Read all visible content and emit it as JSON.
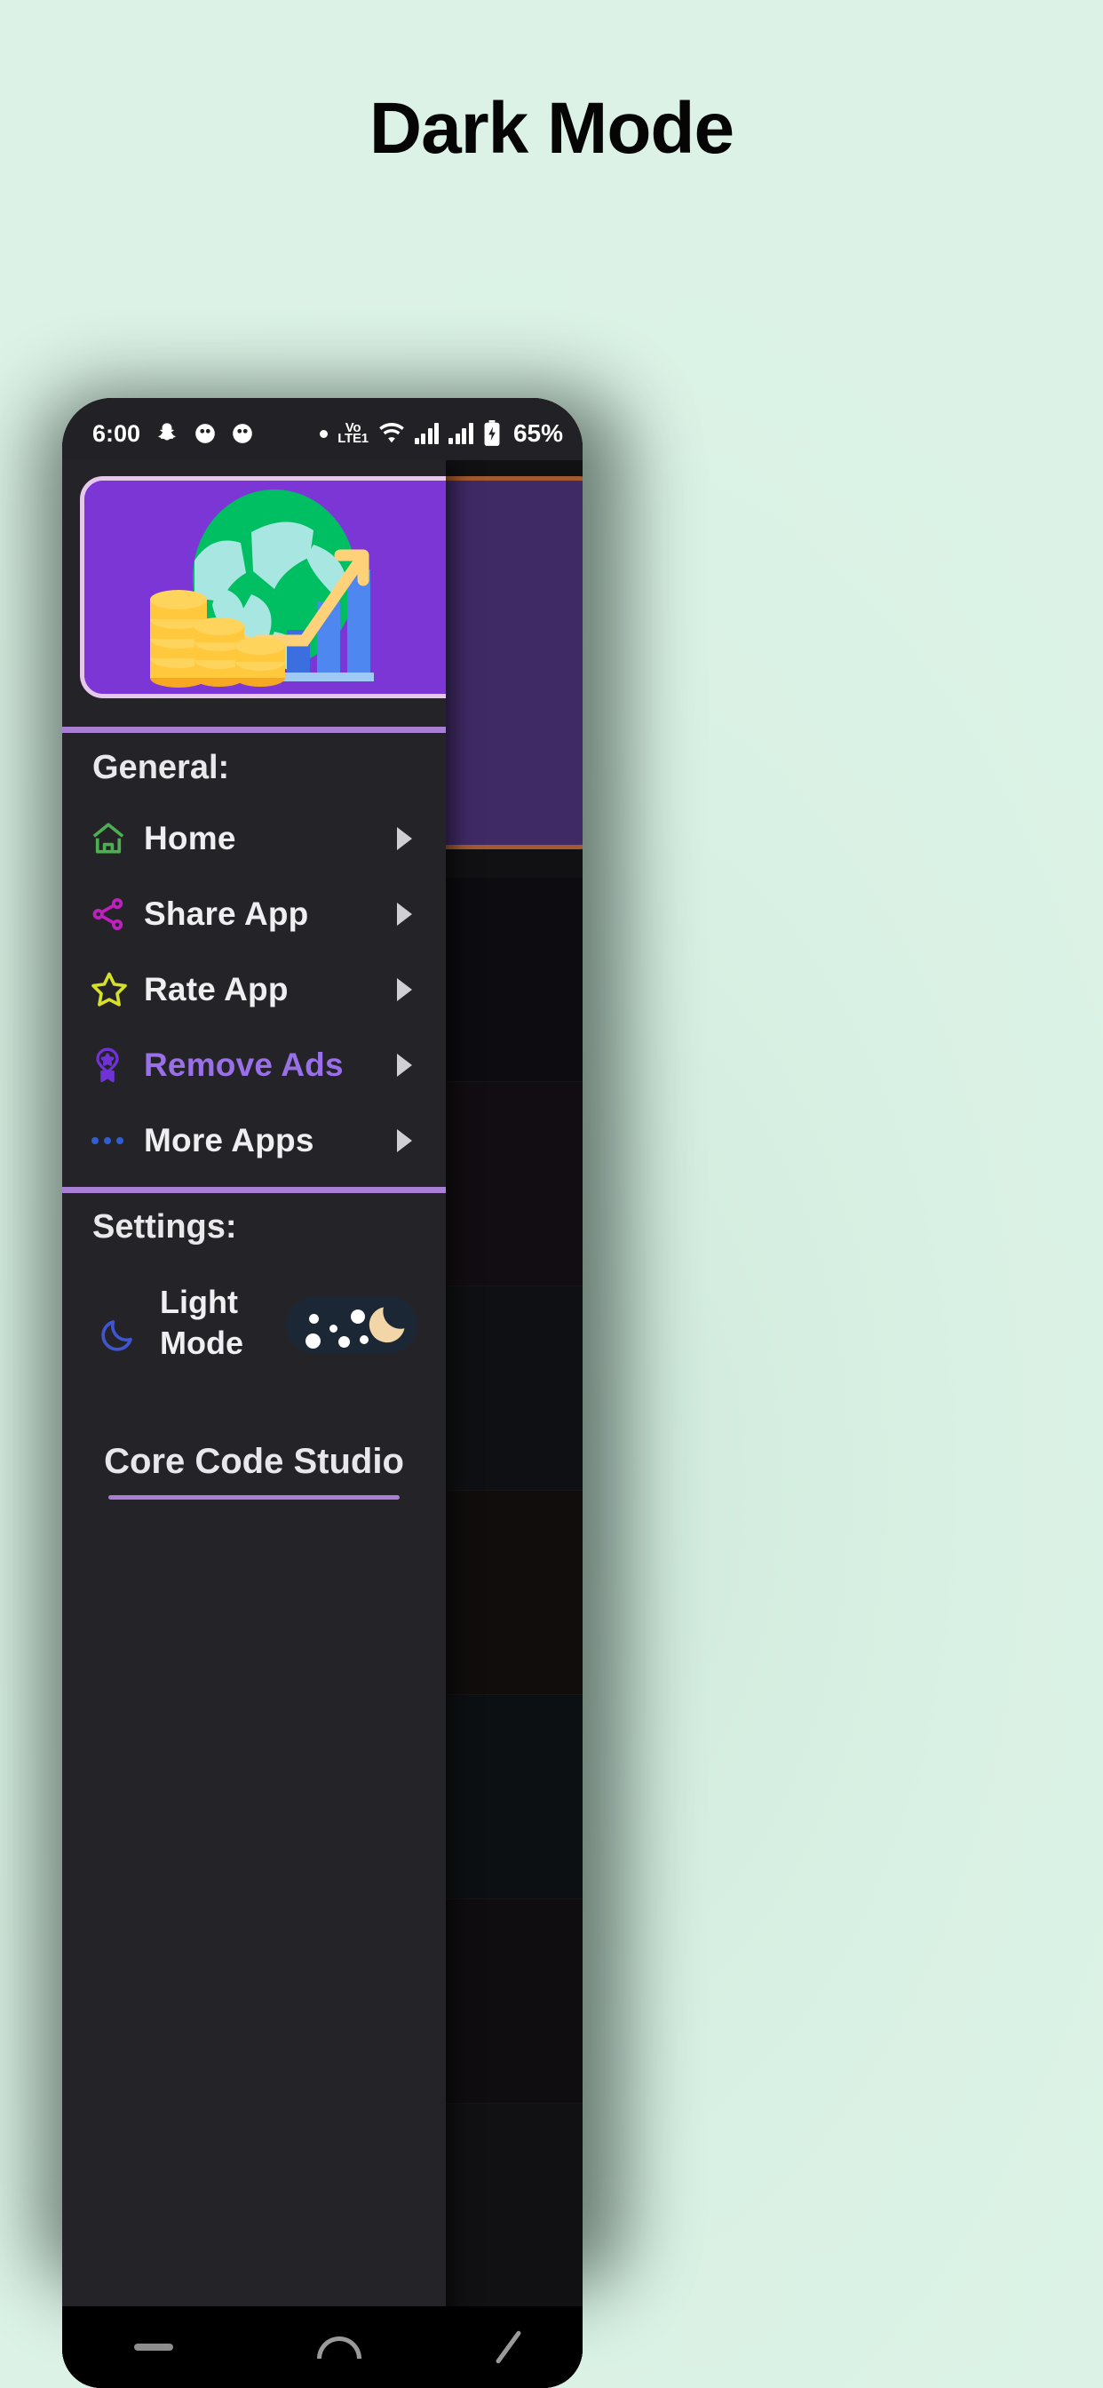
{
  "page": {
    "title": "Dark Mode",
    "background_color": "#d9f1e4"
  },
  "status_bar": {
    "time": "6:00",
    "left_icons": [
      "snapchat-icon",
      "app-badge-icon",
      "app-badge-icon"
    ],
    "network_label": "VoLTE1",
    "network_top": "Vo",
    "network_bottom": "LTE1",
    "right_icons": [
      "dot-icon",
      "volte-icon",
      "wifi-icon",
      "signal-bars-icon",
      "signal-bars-icon",
      "battery-charging-icon"
    ],
    "battery": "65%"
  },
  "drawer": {
    "hero": {
      "name": "finance-globe-illustration",
      "background_color": "#7c36d6",
      "border_color": "#e6c8ec"
    },
    "sections": [
      {
        "heading": "General:",
        "items": [
          {
            "label": "Home",
            "icon": "home-icon",
            "icon_color": "#4caf50",
            "accent": false
          },
          {
            "label": "Share App",
            "icon": "share-icon",
            "icon_color": "#c020c0",
            "accent": false
          },
          {
            "label": "Rate App",
            "icon": "star-icon",
            "icon_color": "#d4e02a",
            "accent": false
          },
          {
            "label": "Remove Ads",
            "icon": "badge-star-icon",
            "icon_color": "#6f32d6",
            "accent": true
          },
          {
            "label": "More Apps",
            "icon": "more-dots-icon",
            "icon_color": "#2f5fd0",
            "accent": false
          }
        ]
      },
      {
        "heading": "Settings:",
        "theme": {
          "label": "Light Mode",
          "icon": "moon-icon",
          "icon_color": "#4055d0",
          "toggle": {
            "name": "dark-mode-toggle",
            "state": "on",
            "track_color": "#1c2736",
            "knob_icon": "crescent-moon-icon",
            "knob_color": "#f2d6a8"
          }
        }
      }
    ],
    "footer": {
      "brand": "Core Code Studio",
      "rule_color": "#a87fd4"
    },
    "divider_color": "#a87fd4"
  },
  "background_content": {
    "hero_card": {
      "name": "hero-card-behind",
      "fill": "#402a66",
      "border": "#a35a30"
    },
    "rows": [
      {
        "chevron": "›"
      },
      {
        "chevron": "›"
      },
      {
        "chevron": "›"
      },
      {
        "chevron": "›"
      },
      {
        "chevron": "›"
      },
      {
        "chevron": "›"
      }
    ],
    "avatar_button": {
      "name": "profile-avatar-button",
      "icon": "person-icon"
    }
  },
  "nav_bar": {
    "items": [
      "recents-icon",
      "home-icon",
      "back-icon"
    ]
  }
}
